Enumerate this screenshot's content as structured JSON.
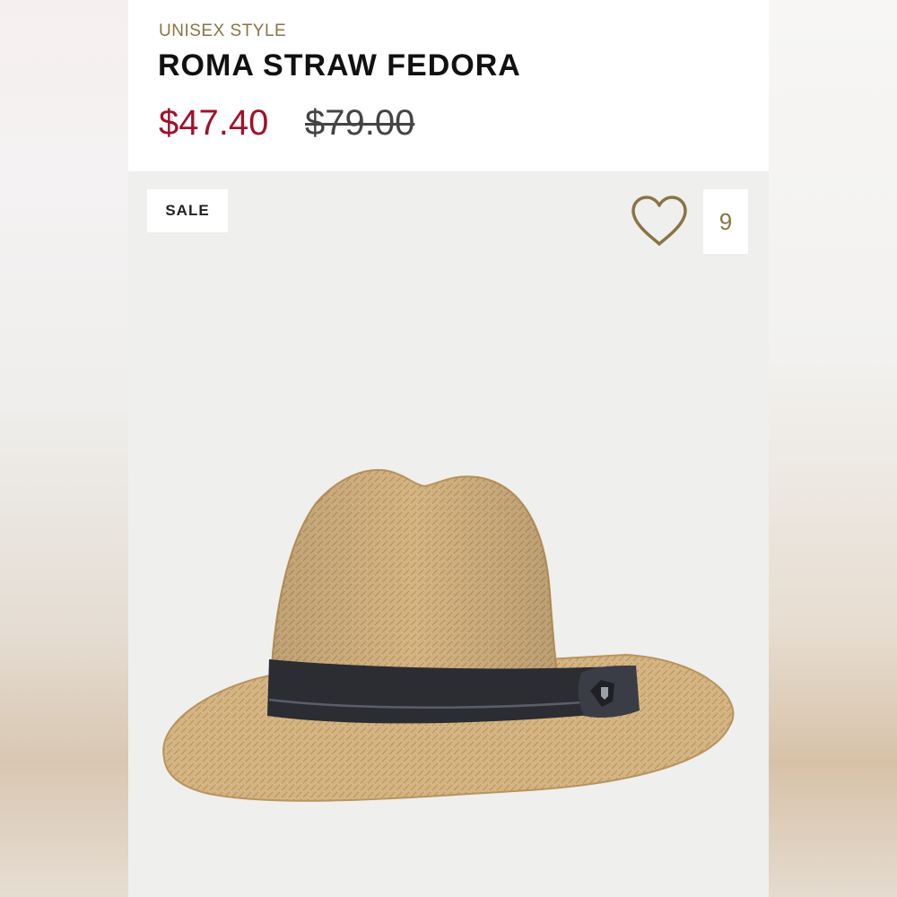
{
  "product": {
    "category": "UNISEX STYLE",
    "name": "ROMA STRAW FEDORA",
    "sale_price": "$47.40",
    "original_price": "$79.00"
  },
  "badge": {
    "label": "SALE"
  },
  "favorites": {
    "icon": "heart-icon",
    "count": "9"
  },
  "colors": {
    "accent_gold": "#8a7445",
    "sale_red": "#a0122a",
    "straw": "#d6b584",
    "hat_band": "#2b2d33"
  }
}
